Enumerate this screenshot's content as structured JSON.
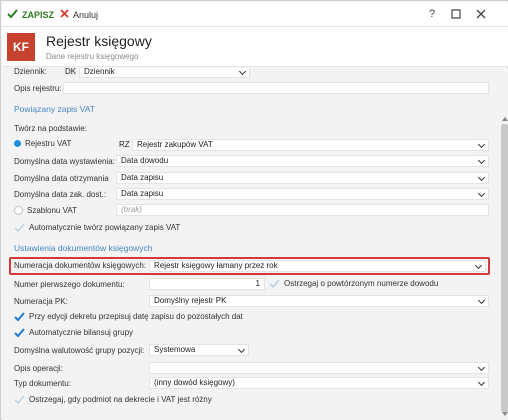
{
  "toolbar": {
    "save_label": "ZAPISZ",
    "cancel_label": "Anuluj",
    "help": "?",
    "colors": {
      "save": "#2d7d22",
      "cancel": "#d33c2c"
    }
  },
  "header": {
    "badge": "KF",
    "badge_color": "#c7412f",
    "title": "Rejestr księgowy",
    "subtitle": "Dane rejestru księgowego"
  },
  "form": {
    "dziennik_label": "Dziennik:",
    "dziennik_code": "DK",
    "dziennik_value": "Dziennik",
    "opis_rejestru_label": "Opis rejestru:",
    "opis_rejestru_value": "",
    "vat_section": "Powiązany zapis VAT",
    "tworz_label": "Twórz na podstawie:",
    "rejestr_vat_label": "Rejestru VAT",
    "rejestr_vat_code": "RZ",
    "rejestr_vat_value": "Rejestr zakupów VAT",
    "data_wyst_label": "Domyślna data wystawienia:",
    "data_wyst_value": "Data dowodu",
    "data_otrz_label": "Domyślna data otrzymania",
    "data_otrz_value": "Data zapisu",
    "data_zak_label": "Domyślna data zak. dost.:",
    "data_zak_value": "Data zapisu",
    "szablon_label": "Szablonu VAT",
    "szablon_value": "(brak)",
    "auto_vat_label": "Automatycznie twórz powiązany zapis VAT",
    "docs_section": "Ustawienia dokumentów księgowych",
    "numeracja_label": "Numeracja dokumentów księgowych:",
    "numeracja_value": "Rejestr księgowy łamany przez rok",
    "nr_pierwszy_label": "Numer pierwszego dokumentu:",
    "nr_pierwszy_value": "1",
    "ostrzegaj_label": "Ostrzegaj o powtórzonym numerze dowodu",
    "numeracja_pk_label": "Numeracja PK:",
    "numeracja_pk_value": "Domyślny rejestr PK",
    "przy_edycji_label": "Przy edycji dekretu przepisuj datę zapisu do pozostałych dat",
    "auto_bilansuj_label": "Automatycznie bilansuj grupy",
    "walutowosc_label": "Domyślna walutowość grupy pozycji:",
    "walutowosc_value": "Systemowa",
    "opis_operacji_label": "Opis operacji:",
    "opis_operacji_value": "",
    "typ_dok_label": "Typ dokumentu:",
    "typ_dok_value": "(inny dowód księgowy)",
    "ostrzegaj_vat_label": "Ostrzegaj, gdy podmiot na dekrecie i VAT jest różny"
  },
  "icons": [
    "check-icon",
    "x-icon",
    "help-icon",
    "maximize-icon",
    "close-icon",
    "chevron-down-icon",
    "scroll-up-icon",
    "scroll-down-icon"
  ],
  "accent": "#4a86c5",
  "highlight_color": "#d23a3a"
}
